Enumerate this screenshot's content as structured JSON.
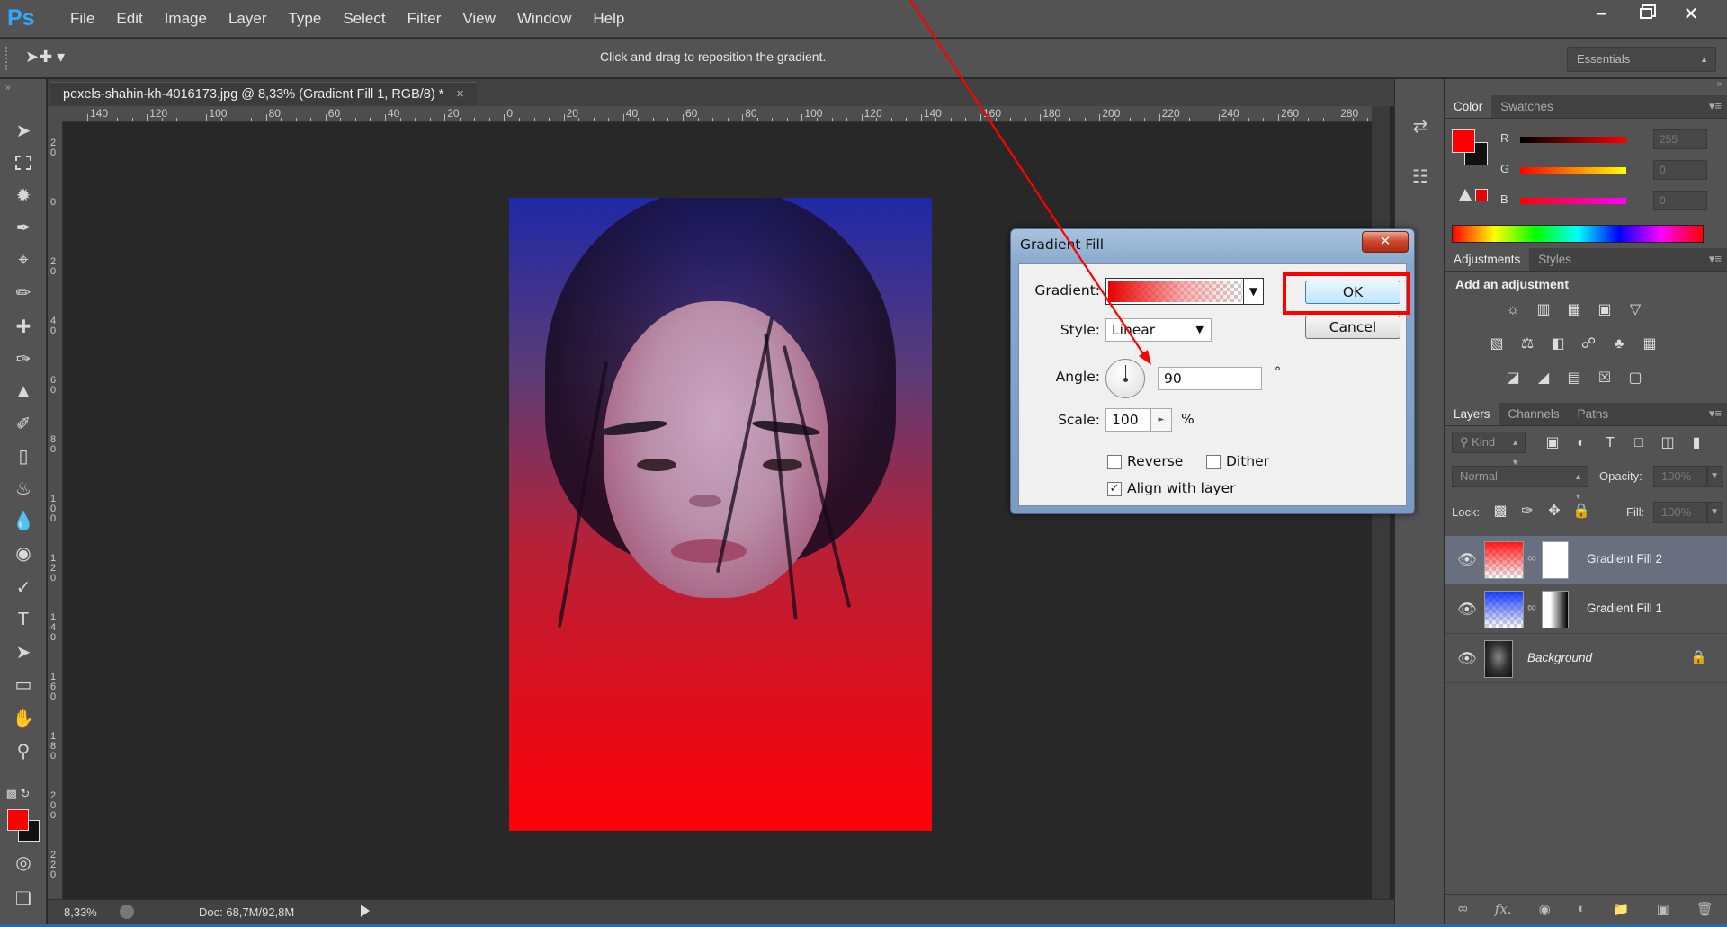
{
  "app": {
    "logo": "Ps"
  },
  "menu": [
    "File",
    "Edit",
    "Image",
    "Layer",
    "Type",
    "Select",
    "Filter",
    "View",
    "Window",
    "Help"
  ],
  "options_bar": {
    "hint": "Click and drag to reposition the gradient.",
    "workspace": "Essentials"
  },
  "document": {
    "tab_title": "pexels-shahin-kh-4016173.jpg @ 8,33% (Gradient Fill 1, RGB/8) *",
    "zoom": "8,33%",
    "doc_info": "Doc: 68,7M/92,8M",
    "ruler_h": [
      "140",
      "120",
      "100",
      "80",
      "60",
      "40",
      "20",
      "0",
      "20",
      "40",
      "60",
      "80",
      "100",
      "120",
      "140",
      "160",
      "180",
      "200",
      "220",
      "240",
      "260",
      "280"
    ],
    "ruler_v": [
      "2 0",
      "0",
      "2 0",
      "4 0",
      "6 0",
      "8 0",
      "1 0 0",
      "1 2 0",
      "1 4 0",
      "1 6 0",
      "1 8 0",
      "2 0 0",
      "2 2 0"
    ]
  },
  "color_panel": {
    "tabs": [
      "Color",
      "Swatches"
    ],
    "r_label": "R",
    "g_label": "G",
    "b_label": "B",
    "r_value": "255",
    "g_value": "0",
    "b_value": "0",
    "fg": "#ff0000",
    "bg": "#111111"
  },
  "adjustments_panel": {
    "tabs": [
      "Adjustments",
      "Styles"
    ],
    "title": "Add an adjustment"
  },
  "layers_panel": {
    "tabs": [
      "Layers",
      "Channels",
      "Paths"
    ],
    "kind": "Kind",
    "blend_mode": "Normal",
    "opacity_label": "Opacity:",
    "opacity_value": "100%",
    "lock_label": "Lock:",
    "fill_label": "Fill:",
    "fill_value": "100%",
    "layers": [
      {
        "name": "Gradient Fill 2",
        "selected": true
      },
      {
        "name": "Gradient Fill 1",
        "selected": false
      },
      {
        "name": "Background",
        "selected": false
      }
    ]
  },
  "dialog": {
    "title": "Gradient Fill",
    "close": "✕",
    "gradient_label": "Gradient:",
    "style_label": "Style:",
    "style_value": "Linear",
    "angle_label": "Angle:",
    "angle_value": "90",
    "degree_symbol": "°",
    "scale_label": "Scale:",
    "scale_value": "100",
    "percent": "%",
    "reverse_label": "Reverse",
    "dither_label": "Dither",
    "align_label": "Align with layer",
    "reverse_checked": false,
    "dither_checked": false,
    "align_checked": true,
    "ok_label": "OK",
    "cancel_label": "Cancel"
  },
  "colors": {
    "accent_red": "#ff0000",
    "panel_bg": "#535353",
    "canvas_bg": "#282828"
  }
}
